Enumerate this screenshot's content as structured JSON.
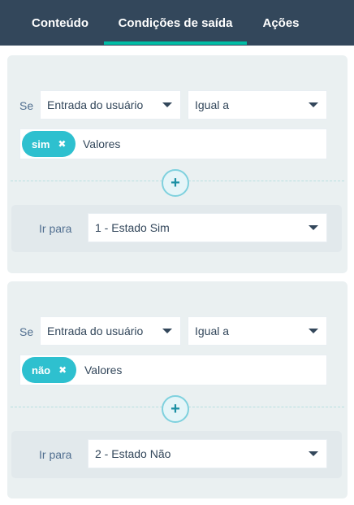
{
  "tabs": [
    {
      "label": "Conteúdo",
      "active": false
    },
    {
      "label": "Condições de saída",
      "active": true
    },
    {
      "label": "Ações",
      "active": false
    }
  ],
  "colors": {
    "header_bg": "#33475b",
    "accent": "#00bda5",
    "chip": "#2ec0cf"
  },
  "rules": [
    {
      "condition_label": "Se",
      "field": "Entrada do usuário",
      "operator": "Igual a",
      "tag": "sim",
      "tag_remove": "✖",
      "values_placeholder": "Valores",
      "add_symbol": "+",
      "goto_label": "Ir para",
      "goto_value": "1 - Estado Sim"
    },
    {
      "condition_label": "Se",
      "field": "Entrada do usuário",
      "operator": "Igual a",
      "tag": "não",
      "tag_remove": "✖",
      "values_placeholder": "Valores",
      "add_symbol": "+",
      "goto_label": "Ir para",
      "goto_value": "2 - Estado Não"
    }
  ]
}
